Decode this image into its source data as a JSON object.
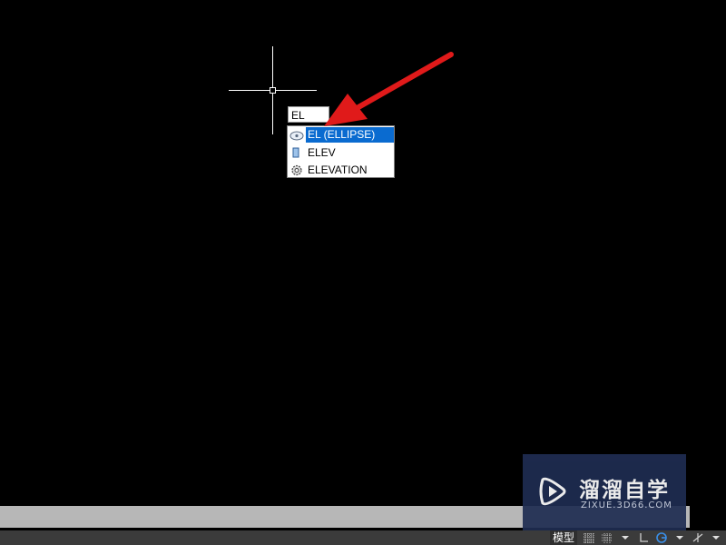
{
  "command_input": {
    "value": "EL"
  },
  "autocomplete": {
    "items": [
      {
        "label": "EL (ELLIPSE)",
        "icon": "ellipse-icon",
        "selected": true
      },
      {
        "label": "ELEV",
        "icon": "elev-icon",
        "selected": false
      },
      {
        "label": "ELEVATION",
        "icon": "gear-icon",
        "selected": false
      }
    ]
  },
  "status_bar": {
    "model_label": "模型"
  },
  "watermark": {
    "title": "溜溜自学",
    "subtitle": "ZIXUE.3D66.COM"
  },
  "colors": {
    "canvas_bg": "#000000",
    "selection": "#0a6bd0",
    "arrow": "#e01a1a",
    "watermark_bg": "#1f2d52",
    "command_bar": "#b7b7b7",
    "status_bar": "#3b3b3b"
  }
}
